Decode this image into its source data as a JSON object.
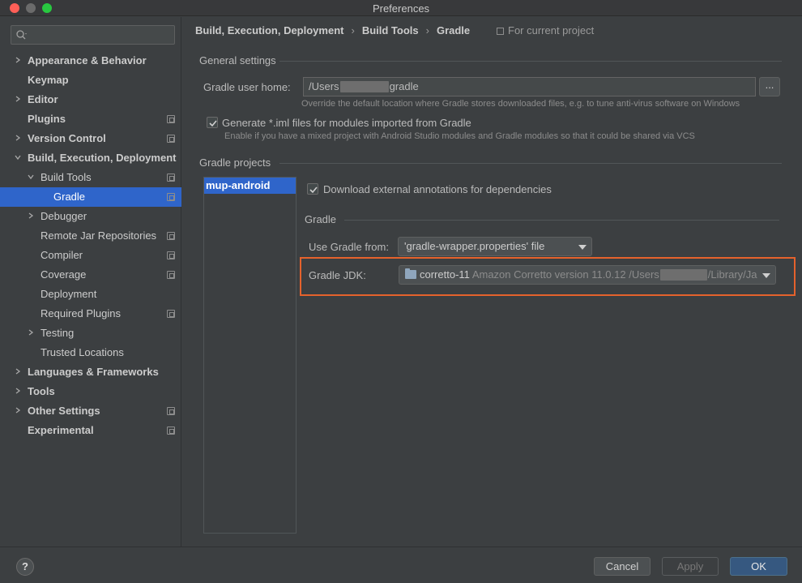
{
  "window": {
    "title": "Preferences"
  },
  "sidebar": {
    "search_value": "",
    "items": [
      {
        "label": "Appearance & Behavior",
        "bold": true,
        "chevron": ">",
        "level": 0,
        "project": false
      },
      {
        "label": "Keymap",
        "bold": true,
        "chevron": "",
        "level": 0,
        "project": false
      },
      {
        "label": "Editor",
        "bold": true,
        "chevron": ">",
        "level": 0,
        "project": false
      },
      {
        "label": "Plugins",
        "bold": true,
        "chevron": "",
        "level": 0,
        "project": true
      },
      {
        "label": "Version Control",
        "bold": true,
        "chevron": ">",
        "level": 0,
        "project": true
      },
      {
        "label": "Build, Execution, Deployment",
        "bold": true,
        "chevron": "v",
        "level": 0,
        "project": false
      },
      {
        "label": "Build Tools",
        "bold": false,
        "chevron": "v",
        "level": 1,
        "project": true
      },
      {
        "label": "Gradle",
        "bold": false,
        "chevron": "",
        "level": 2,
        "project": true,
        "selected": true
      },
      {
        "label": "Debugger",
        "bold": false,
        "chevron": ">",
        "level": 1,
        "project": false
      },
      {
        "label": "Remote Jar Repositories",
        "bold": false,
        "chevron": "",
        "level": 1,
        "project": true
      },
      {
        "label": "Compiler",
        "bold": false,
        "chevron": "",
        "level": 1,
        "project": true
      },
      {
        "label": "Coverage",
        "bold": false,
        "chevron": "",
        "level": 1,
        "project": true
      },
      {
        "label": "Deployment",
        "bold": false,
        "chevron": "",
        "level": 1,
        "project": false
      },
      {
        "label": "Required Plugins",
        "bold": false,
        "chevron": "",
        "level": 1,
        "project": true
      },
      {
        "label": "Testing",
        "bold": false,
        "chevron": ">",
        "level": 1,
        "project": false
      },
      {
        "label": "Trusted Locations",
        "bold": false,
        "chevron": "",
        "level": 1,
        "project": false
      },
      {
        "label": "Languages & Frameworks",
        "bold": true,
        "chevron": ">",
        "level": 0,
        "project": false
      },
      {
        "label": "Tools",
        "bold": true,
        "chevron": ">",
        "level": 0,
        "project": false
      },
      {
        "label": "Other Settings",
        "bold": true,
        "chevron": ">",
        "level": 0,
        "project": true
      },
      {
        "label": "Experimental",
        "bold": true,
        "chevron": "",
        "level": 0,
        "project": true
      }
    ]
  },
  "breadcrumb": {
    "items": [
      "Build, Execution, Deployment",
      "Build Tools",
      "Gradle"
    ],
    "separator": "›",
    "scope": "For current project"
  },
  "general": {
    "title": "General settings",
    "user_home_label": "Gradle user home:",
    "user_home_prefix": "/Users",
    "user_home_suffix": "gradle",
    "browse_label": "...",
    "user_home_hint": "Override the default location where Gradle stores downloaded files, e.g. to tune anti-virus software on Windows",
    "iml_label": "Generate *.iml files for modules imported from Gradle",
    "iml_hint": "Enable if you have a mixed project with Android Studio modules and Gradle modules so that it could be shared via VCS",
    "iml_checked": true
  },
  "projects": {
    "title": "Gradle projects",
    "list": [
      "mup-android"
    ],
    "download_annotations_label": "Download external annotations for dependencies",
    "download_annotations_checked": true,
    "gradle_section_title": "Gradle",
    "use_gradle_from_label": "Use Gradle from:",
    "use_gradle_from_value": "'gradle-wrapper.properties' file",
    "jdk_label": "Gradle JDK:",
    "jdk_name": "corretto-11",
    "jdk_desc": "Amazon Corretto version 11.0.12 /Users",
    "jdk_path_suffix": "/Library/Ja"
  },
  "footer": {
    "help_label": "?",
    "cancel_label": "Cancel",
    "apply_label": "Apply",
    "ok_label": "OK"
  },
  "colors": {
    "selection": "#2f65ca",
    "highlight_box": "#e5622c",
    "ok_button": "#365880"
  }
}
